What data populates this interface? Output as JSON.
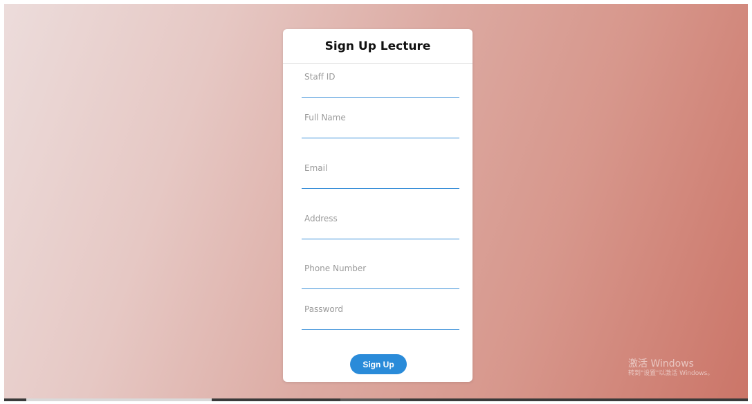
{
  "form": {
    "title": "Sign Up Lecture",
    "fields": [
      {
        "label": "Staff ID",
        "value": ""
      },
      {
        "label": "Full Name",
        "value": ""
      },
      {
        "label": "Email",
        "value": ""
      },
      {
        "label": "Address",
        "value": ""
      },
      {
        "label": "Phone Number",
        "value": ""
      },
      {
        "label": "Password",
        "value": ""
      }
    ],
    "submit_label": "Sign Up"
  },
  "watermark": {
    "title": "激活 Windows",
    "subtitle": "转到\"设置\"以激活 Windows。"
  },
  "colors": {
    "accent": "#2a8bd9",
    "underline": "#3a8fd8",
    "background_start": "#ecdcdb",
    "background_end": "#cb7568"
  }
}
